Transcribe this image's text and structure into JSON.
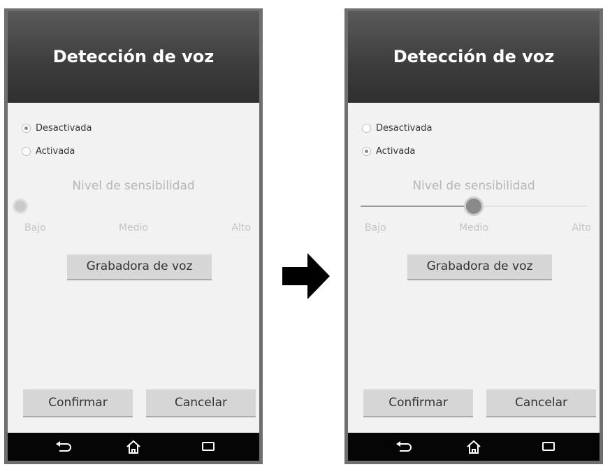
{
  "screens": [
    {
      "title": "Detección de voz",
      "radio_options": [
        {
          "label": "Desactivada",
          "checked": true
        },
        {
          "label": "Activada",
          "checked": false
        }
      ],
      "sensitivity": {
        "label": "Nivel de sensibilidad",
        "low": "Bajo",
        "mid": "Medio",
        "high": "Alto",
        "enabled": false,
        "value": 0.0
      },
      "record_button": "Grabadora de voz",
      "confirm_button": "Confirmar",
      "cancel_button": "Cancelar",
      "nav": {
        "back_icon": "back-icon",
        "home_icon": "home-icon",
        "recent_icon": "recent-apps-icon"
      }
    },
    {
      "title": "Detección de voz",
      "radio_options": [
        {
          "label": "Desactivada",
          "checked": false
        },
        {
          "label": "Activada",
          "checked": true
        }
      ],
      "sensitivity": {
        "label": "Nivel de sensibilidad",
        "low": "Bajo",
        "mid": "Medio",
        "high": "Alto",
        "enabled": true,
        "value": 0.5
      },
      "record_button": "Grabadora de voz",
      "confirm_button": "Confirmar",
      "cancel_button": "Cancelar",
      "nav": {
        "back_icon": "back-icon",
        "home_icon": "home-icon",
        "recent_icon": "recent-apps-icon"
      }
    }
  ],
  "transition_icon": "right-arrow-icon"
}
